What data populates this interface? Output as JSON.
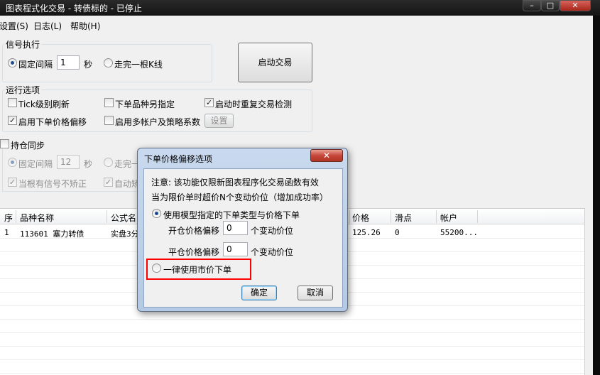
{
  "window": {
    "title": "图表程式化交易 - 转债标的 - 已停止",
    "controls": {
      "minimize": "–",
      "maximize": "□",
      "close": "✕"
    }
  },
  "menu": [
    "设置(S)",
    "日志(L)",
    "帮助(H)"
  ],
  "signal": {
    "legend": "信号执行",
    "fixed_interval_label": "固定间隔",
    "fixed_interval_value": "1",
    "seconds_unit": "秒",
    "wait_bar_label": "走完一根K线"
  },
  "start_button": "启动交易",
  "run_options": {
    "legend": "运行选项",
    "tick_refresh": "Tick级别刷新",
    "order_variety": "下单品种另指定",
    "startup_check": "启动时重复交易检测",
    "price_offset": "启用下单价格偏移",
    "multi_account": "启用多帐户及策略系数",
    "settings_button": "设置"
  },
  "position_sync": {
    "legend": "持仓同步",
    "fixed_interval_label": "固定间隔",
    "fixed_interval_value": "12",
    "seconds_unit": "秒",
    "wait_bar_partial": "走完一",
    "no_correct_label": "当根有信号不矫正",
    "auto_partial": "自动矫"
  },
  "table": {
    "headers": [
      "序",
      "品种名称",
      "公式名",
      "价格",
      "滑点",
      "帐户"
    ],
    "rows": [
      {
        "seq": "1",
        "name": "113601 塞力转债",
        "formula": "实盘3分",
        "price": "125.26",
        "slippage": "0",
        "account": "55200..."
      }
    ]
  },
  "dialog": {
    "title": "下单价格偏移选项",
    "close": "✕",
    "note_line1": "注意: 该功能仅限新图表程序化交易函数有效",
    "note_line2": "当为限价单时超价N个变动价位（增加成功率）",
    "option_model": "使用模型指定的下单类型与价格下单",
    "open_offset_label": "开仓价格偏移",
    "open_offset_value": "0",
    "close_offset_label": "平仓价格偏移",
    "close_offset_value": "0",
    "tick_unit": "个变动价位",
    "option_market": "一律使用市价下单",
    "ok": "确定",
    "cancel": "取消"
  }
}
